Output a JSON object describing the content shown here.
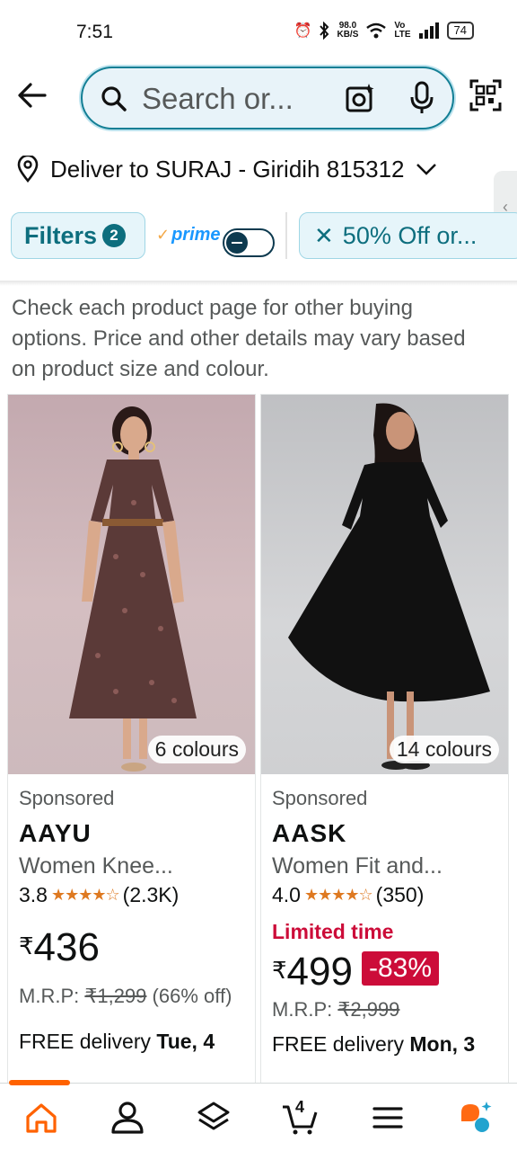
{
  "status_bar": {
    "time": "7:51",
    "net_speed_value": "98.0",
    "net_speed_unit": "KB/S",
    "battery": "74"
  },
  "header": {
    "search_placeholder": "Search or..."
  },
  "delivery": {
    "text": "Deliver to SURAJ - Giridih 815312"
  },
  "filters": {
    "label": "Filters",
    "count": "2",
    "prime_label": "prime",
    "prime_toggle_on": false,
    "offer_chip": "50% Off or..."
  },
  "notice": "Check each product page for other buying options. Price and other details may vary based on product size and colour.",
  "products": [
    {
      "colours": "6 colours",
      "sponsored": "Sponsored",
      "brand": "AAYU",
      "title": "Women Knee...",
      "rating": "3.8",
      "rating_count": "(2.3K)",
      "price_symbol": "₹",
      "price": "436",
      "mrp_label": "M.R.P:",
      "mrp": "₹1,299",
      "discount_text": "(66% off)",
      "delivery_prefix": "FREE delivery",
      "delivery_date": "Tue, 4"
    },
    {
      "colours": "14 colours",
      "sponsored": "Sponsored",
      "brand": "AASK",
      "title": "Women Fit and...",
      "rating": "4.0",
      "rating_count": "(350)",
      "deal_label": "Limited time",
      "price_symbol": "₹",
      "price": "499",
      "discount_badge": "-83%",
      "mrp_label": "M.R.P:",
      "mrp": "₹2,999",
      "delivery_prefix": "FREE delivery",
      "delivery_date": "Mon, 3"
    }
  ],
  "bottom_nav": {
    "cart_count": "4",
    "items": [
      "home-icon",
      "profile-icon",
      "layers-icon",
      "cart-icon",
      "menu-icon",
      "rufus-icon"
    ]
  },
  "colors": {
    "accent_teal": "#0d6e7e",
    "search_border": "#137f95",
    "deal_red": "#cc0c39",
    "star_orange": "#de7921",
    "nav_active": "#ff6200"
  }
}
